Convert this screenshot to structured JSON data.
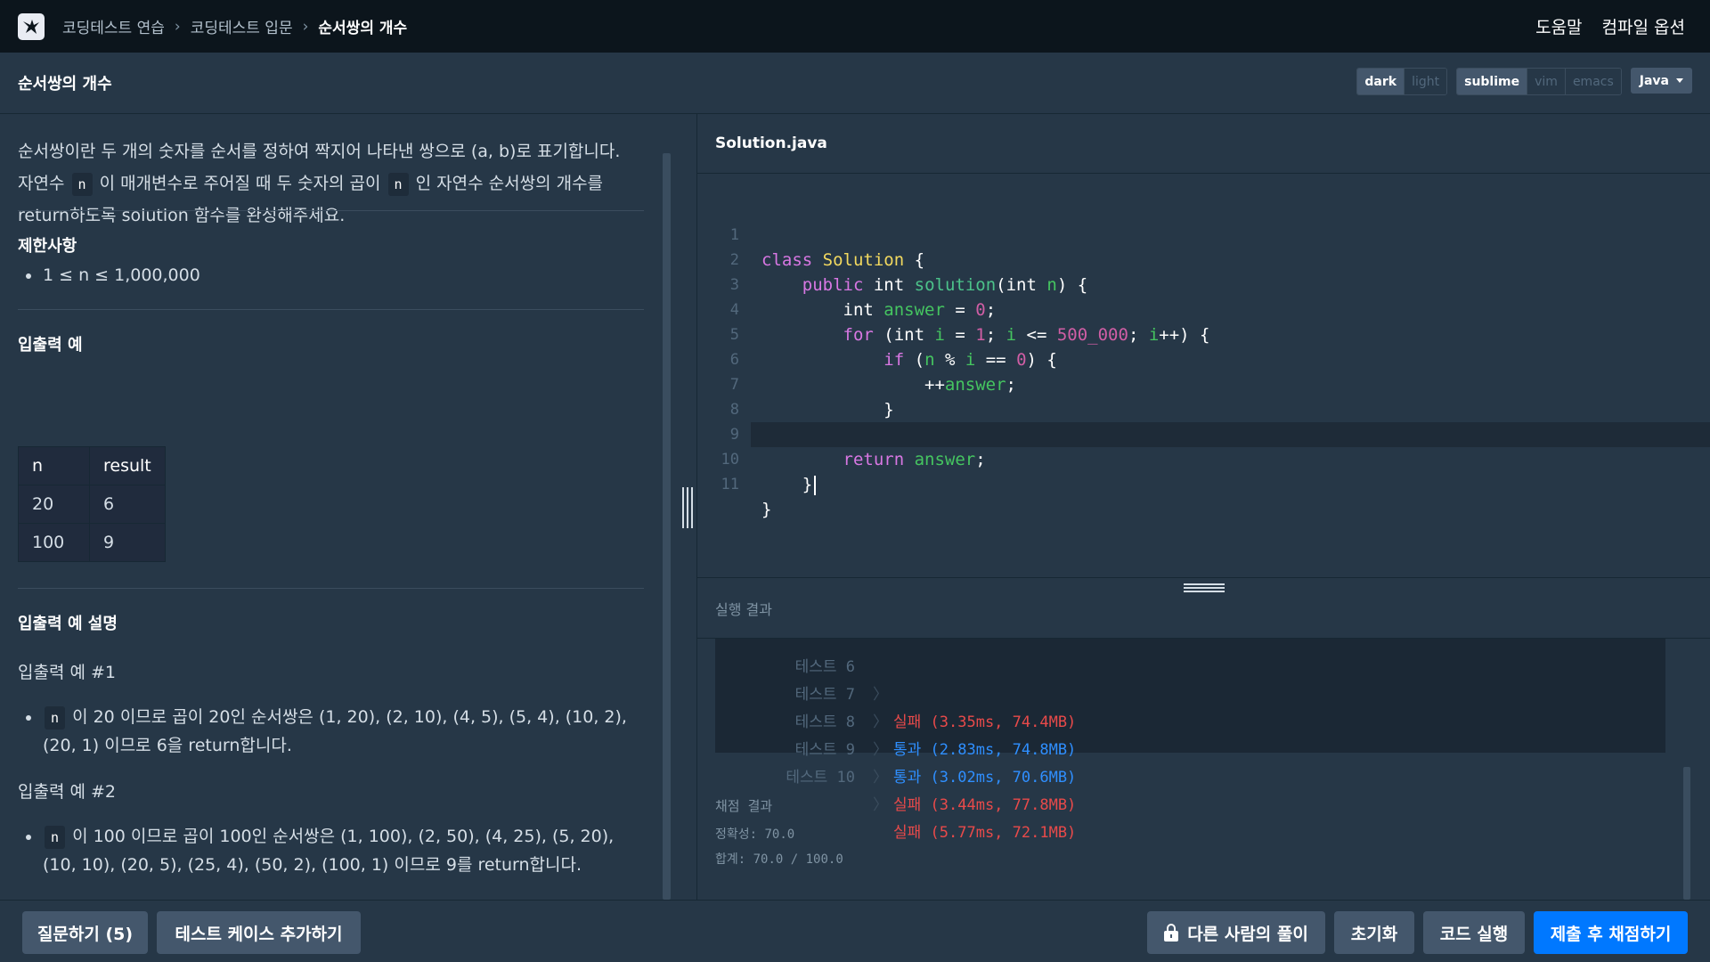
{
  "nav": {
    "breadcrumb": [
      "코딩테스트 연습",
      "코딩테스트 입문",
      "순서쌍의 개수"
    ],
    "help": "도움말",
    "compile_options": "컴파일 옵션"
  },
  "header": {
    "title": "순서쌍의 개수",
    "themes": [
      "dark",
      "light"
    ],
    "active_theme": "dark",
    "keymaps": [
      "sublime",
      "vim",
      "emacs"
    ],
    "active_keymap": "sublime",
    "language": "Java"
  },
  "problem": {
    "desc_1": "순서쌍이란 두 개의 숫자를 순서를 정하여 짝지어 나타낸 쌍으로 (a, b)로 표기합니다.",
    "desc_2a": "자연수",
    "desc_var": "n",
    "desc_2b": "이 매개변수로 주어질 때 두 숫자의 곱이",
    "desc_2c": "인 자연수 순서쌍의 개수를",
    "desc_3": "return하도록 solution 함수를 완성해주세요.",
    "constraints_title": "제한사항",
    "constraint_1": "1 ≤ n ≤ 1,000,000",
    "io_title": "입출력 예",
    "io_headers": [
      "n",
      "result"
    ],
    "io_rows": [
      [
        "20",
        "6"
      ],
      [
        "100",
        "9"
      ]
    ],
    "explain_title": "입출력 예 설명",
    "ex1_title": "입출력 예 #1",
    "ex1_line1": "이 20 이므로 곱이 20인 순서쌍은 (1, 20), (2, 10), (4, 5), (5, 4), (10, 2),",
    "ex1_line2": "(20, 1) 이므로 6을 return합니다.",
    "ex2_title": "입출력 예 #2",
    "ex2_line1": "이 100 이므로 곱이 100인 순서쌍은 (1, 100), (2, 50), (4, 25), (5, 20),",
    "ex2_line2": "(10, 10), (20, 5), (25, 4), (50, 2), (100, 1) 이므로 9를 return합니다."
  },
  "editor": {
    "filename": "Solution.java",
    "line_numbers": [
      "1",
      "2",
      "3",
      "4",
      "5",
      "6",
      "7",
      "8",
      "9",
      "10",
      "11"
    ],
    "tokens": {
      "class": "class",
      "Solution": "Solution",
      "brace_open": "{",
      "brace_close": "}",
      "public": "public",
      "int": "int",
      "solution": "solution",
      "answer": "answer",
      "zero": "0",
      "one": "1",
      "limit": "500_000",
      "for": "for",
      "i": "i",
      "if": "if",
      "n": "n",
      "return": "return"
    }
  },
  "result": {
    "title": "실행 결과",
    "tests": [
      {
        "name": "테스트 6",
        "status": "실패",
        "detail": "(3.35ms, 74.4MB)",
        "passed": false
      },
      {
        "name": "테스트 7",
        "status": "통과",
        "detail": "(2.83ms, 74.8MB)",
        "passed": true
      },
      {
        "name": "테스트 8",
        "status": "통과",
        "detail": "(3.02ms, 70.6MB)",
        "passed": true
      },
      {
        "name": "테스트 9",
        "status": "실패",
        "detail": "(3.44ms, 77.8MB)",
        "passed": false
      },
      {
        "name": "테스트 10",
        "status": "실패",
        "detail": "(5.77ms, 72.1MB)",
        "passed": false
      }
    ],
    "arrow": "〉",
    "score_title": "채점 결과",
    "accuracy": "정확성: 70.0",
    "total": "합계: 70.0 / 100.0"
  },
  "footer": {
    "ask": "질문하기 (5)",
    "add_testcase": "테스트 케이스 추가하기",
    "others": "다른 사람의 풀이",
    "reset": "초기화",
    "run": "코드 실행",
    "submit": "제출 후 채점하기"
  },
  "colors": {
    "nav_bg": "#0c151c",
    "panel_bg": "#263747",
    "primary": "#0078ff",
    "fail": "#e84a4a",
    "pass": "#2f8fff"
  }
}
